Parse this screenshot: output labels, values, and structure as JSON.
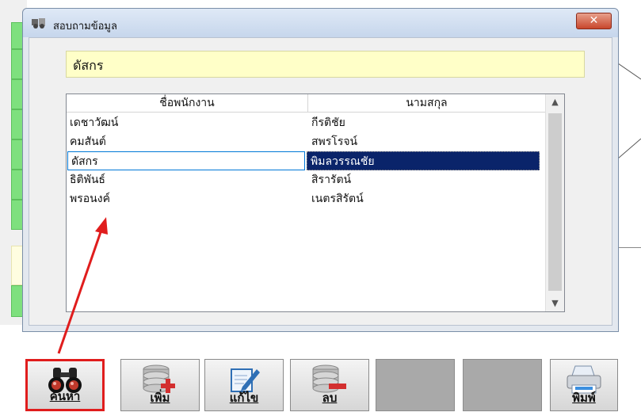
{
  "window": {
    "title": "สอบถามข้อมูล",
    "close_label": "✕"
  },
  "search": {
    "value": "ดัสกร"
  },
  "table": {
    "columns": [
      "ชื่อพนักงาน",
      "นามสกุล"
    ],
    "rows": [
      {
        "first": "เดชาวัฒน์",
        "last": "กีรติชัย"
      },
      {
        "first": "คมสันต์",
        "last": "สพรโรจน์"
      },
      {
        "first": "ดัสกร",
        "last": "พิมลวรรณชัย"
      },
      {
        "first": "ธิติพันธ์",
        "last": "สิรารัตน์"
      },
      {
        "first": "พรอนงค์",
        "last": "เนตรสิรัตน์"
      }
    ],
    "selected_index": 2
  },
  "toolbar": {
    "search_label": "ค้นหา",
    "add_label": "เพิ่ม",
    "edit_label": "แก้ไข",
    "delete_label": "ลบ",
    "print_label": "พิมพ์"
  },
  "colors": {
    "highlight": "#0a246a",
    "search_bg": "#ffffc8",
    "arrow": "#e01d1d"
  },
  "icons": [
    "binoculars-icon",
    "add-database-icon",
    "edit-document-icon",
    "delete-database-icon",
    "printer-icon"
  ]
}
